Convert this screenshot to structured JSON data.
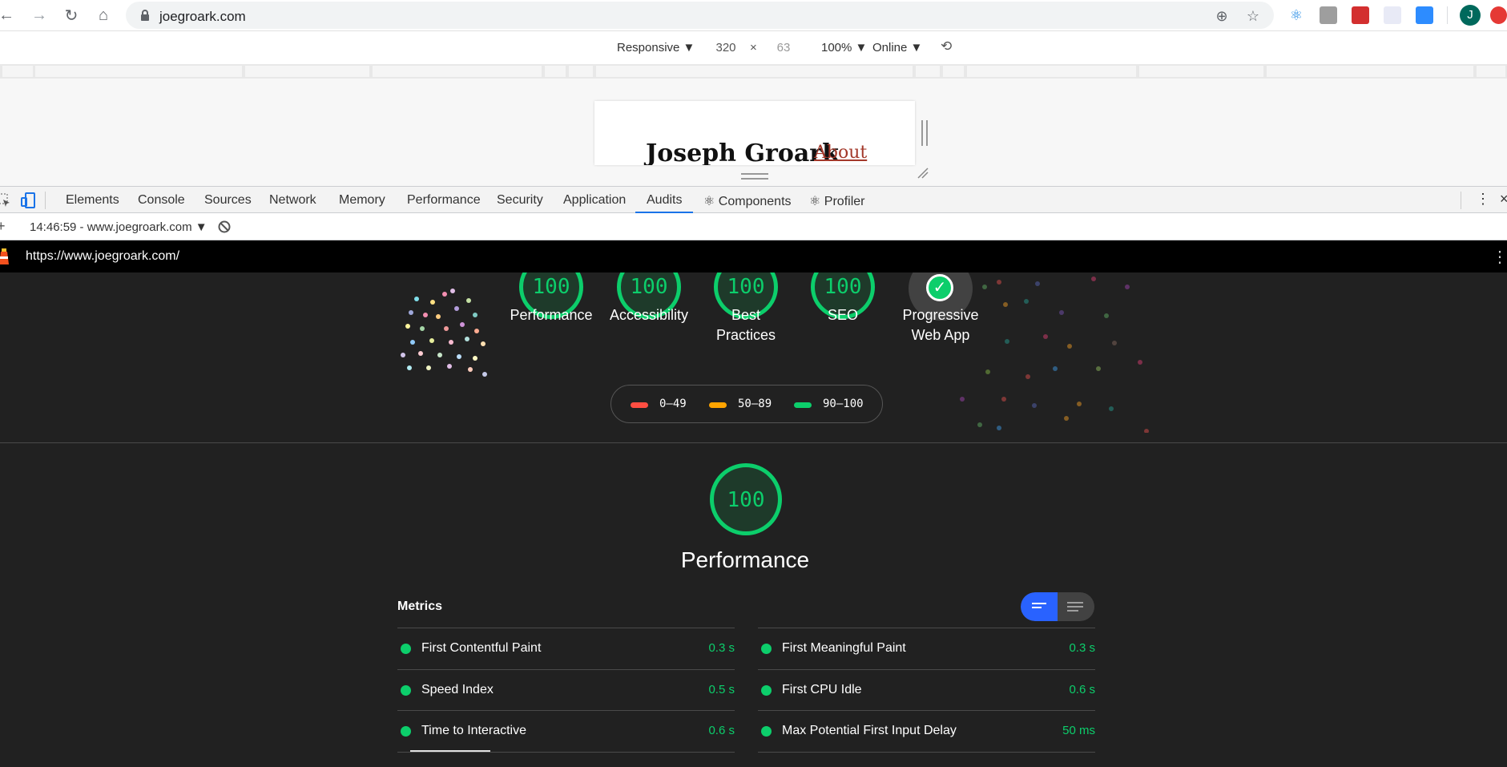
{
  "browser": {
    "url": "joegroark.com",
    "nav_icons": [
      "back-icon",
      "forward-icon",
      "reload-icon",
      "home-icon"
    ],
    "avatar_letter": "J"
  },
  "device_toolbar": {
    "mode": "Responsive ▼",
    "width": "320",
    "times": "×",
    "height": "63",
    "zoom": "100% ▼",
    "network": "Online ▼"
  },
  "page": {
    "site_name": "Joseph Groark",
    "about_link": "About"
  },
  "devtools": {
    "tabs": [
      "Elements",
      "Console",
      "Sources",
      "Network",
      "Memory",
      "Performance",
      "Security",
      "Application",
      "Audits",
      "⚛ Components",
      "⚛ Profiler"
    ],
    "active_tab": "Audits",
    "audit_run": "14:46:59 - www.joegroark.com ▼"
  },
  "lighthouse": {
    "report_url": "https://www.joegroark.com/",
    "categories": [
      {
        "label": "Performance",
        "score": "100"
      },
      {
        "label": "Accessibility",
        "score": "100"
      },
      {
        "label": "Best Practices",
        "score": "100"
      },
      {
        "label": "SEO",
        "score": "100"
      },
      {
        "label": "Progressive Web App",
        "score": ""
      }
    ],
    "legend": [
      {
        "range": "0–49",
        "color": "#ff4e42"
      },
      {
        "range": "50–89",
        "color": "#ffa400"
      },
      {
        "range": "90–100",
        "color": "#0cce6b"
      }
    ],
    "performance": {
      "score": "100",
      "title": "Performance",
      "metrics_title": "Metrics",
      "metrics": [
        {
          "label": "First Contentful Paint",
          "value": "0.3 s"
        },
        {
          "label": "First Meaningful Paint",
          "value": "0.3 s"
        },
        {
          "label": "Speed Index",
          "value": "0.5 s"
        },
        {
          "label": "First CPU Idle",
          "value": "0.6 s"
        },
        {
          "label": "Time to Interactive",
          "value": "0.6 s"
        },
        {
          "label": "Max Potential First Input Delay",
          "value": "50 ms"
        }
      ]
    }
  },
  "colors": {
    "pass": "#0cce6b",
    "report_bg": "#212121",
    "toggle_active": "#2962ff"
  }
}
